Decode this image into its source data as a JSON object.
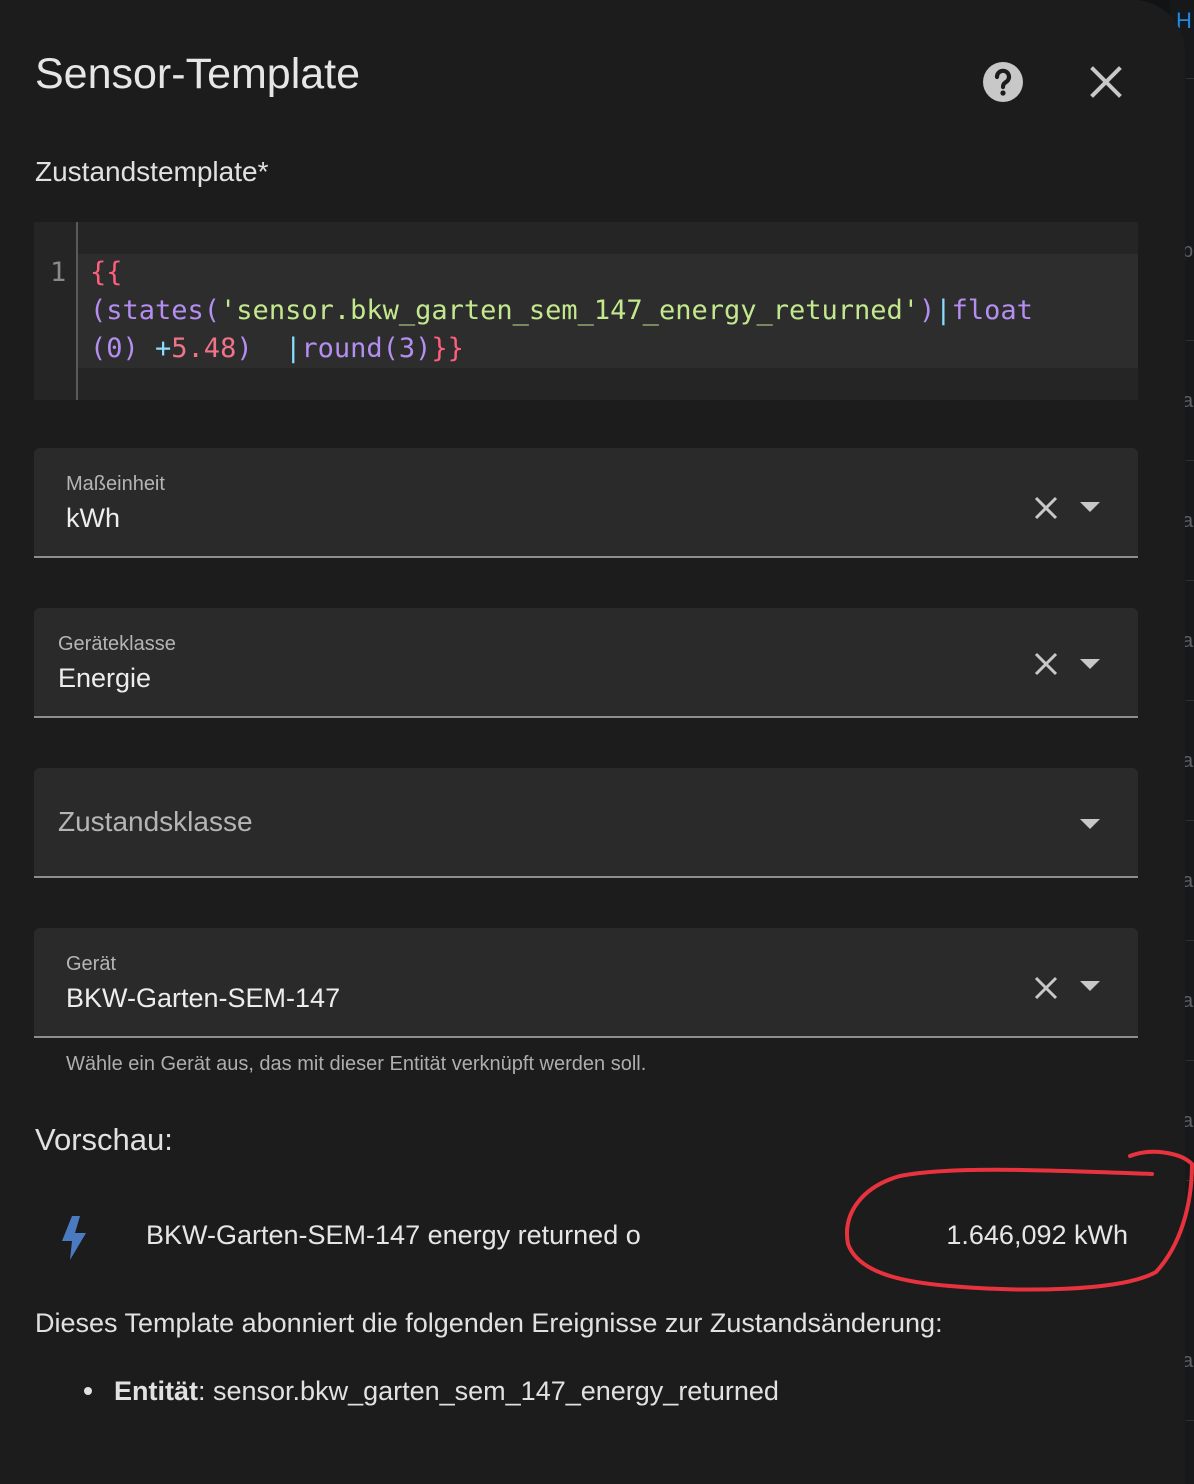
{
  "dialog": {
    "title": "Sensor-Template",
    "help_icon": "help-circle-icon",
    "close_icon": "close-icon"
  },
  "state_template": {
    "label": "Zustandstemplate*",
    "line_number": "1",
    "code_lines": [
      "{{",
      "(states('sensor.bkw_garten_sem_147_energy_returned')|float",
      "(0) +5.48)  |round(3)}}"
    ]
  },
  "fields": {
    "unit": {
      "label": "Maßeinheit",
      "value": "kWh"
    },
    "device_class": {
      "label": "Geräteklasse",
      "value": "Energie"
    },
    "state_class": {
      "placeholder": "Zustandsklasse"
    },
    "device": {
      "label": "Gerät",
      "value": "BKW-Garten-SEM-147",
      "helper": "Wähle ein Gerät aus, das mit dieser Entität verknüpft werden soll."
    }
  },
  "preview": {
    "heading": "Vorschau:",
    "icon": "flash-icon",
    "entity_name": "BKW-Garten-SEM-147 energy returned o",
    "value": "1.646,092 kWh",
    "annotation_color": "#e8333f"
  },
  "subscriptions": {
    "text": "Dieses Template abonniert die folgenden Ereignisse zur Zustandsänderung:",
    "items": [
      {
        "key": "Entität",
        "value": ": sensor.bkw_garten_sem_147_energy_returned"
      }
    ]
  },
  "background": {
    "fragments": [
      "H",
      "p",
      "a"
    ]
  },
  "colors": {
    "dialog_bg": "#1c1c1c",
    "field_bg": "#2a2a2a",
    "accent": "#1e88e5",
    "icon_gray": "#c8c8c8",
    "flash_blue": "#4a7bc0"
  }
}
